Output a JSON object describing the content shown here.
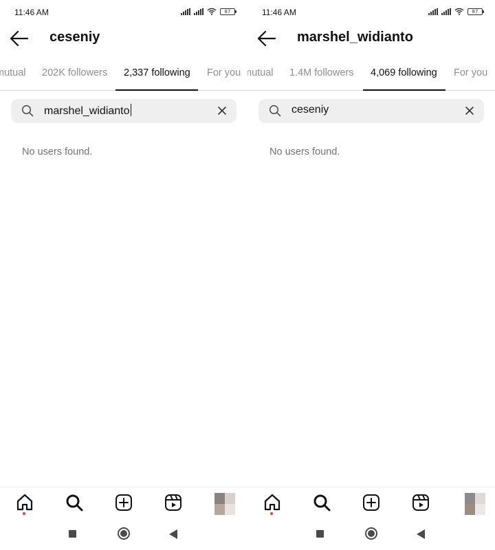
{
  "left": {
    "status": {
      "time": "11:46 AM",
      "battery": "87"
    },
    "header": {
      "username": "ceseniy"
    },
    "tabs": [
      {
        "label": "mutual",
        "active": false
      },
      {
        "label": "202K followers",
        "active": false
      },
      {
        "label": "2,337 following",
        "active": true
      },
      {
        "label": "For you",
        "active": false
      }
    ],
    "search": {
      "value": "marshel_widianto",
      "focused": true
    },
    "empty_message": "No users found."
  },
  "right": {
    "status": {
      "time": "11:46 AM",
      "battery": "87"
    },
    "header": {
      "username": "marshel_widianto"
    },
    "tabs": [
      {
        "label": "mutual",
        "active": false
      },
      {
        "label": "1.4M followers",
        "active": false
      },
      {
        "label": "4,069 following",
        "active": true
      },
      {
        "label": "For you",
        "active": false
      }
    ],
    "search": {
      "value": "ceseniy",
      "focused": false
    },
    "empty_message": "No users found."
  },
  "nav_icons": [
    "home-icon",
    "search-icon",
    "create-icon",
    "reels-icon",
    "profile-avatar"
  ],
  "colors": {
    "notification_dot": "#ff3040",
    "active_tab": "#111111",
    "inactive_tab": "#8e8e8e",
    "search_bg": "#efefef"
  }
}
